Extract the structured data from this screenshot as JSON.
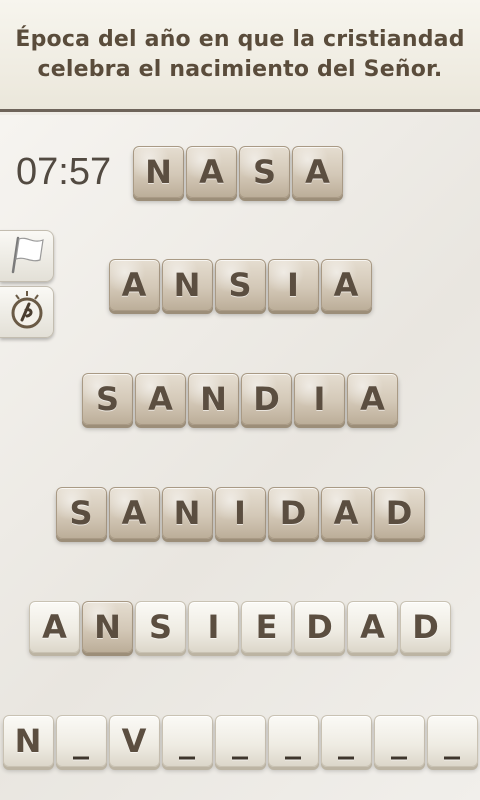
{
  "clue": {
    "line1": "Época del año en que la cristiandad",
    "line2": "celebra el nacimiento del Señor."
  },
  "timer": "07:57",
  "side_buttons": [
    {
      "icon": "flag-icon"
    },
    {
      "icon": "hint-bulb-icon"
    }
  ],
  "rows": [
    {
      "word": "NASA",
      "letters": [
        "N",
        "A",
        "S",
        "A"
      ],
      "style": [
        "dark",
        "dark",
        "dark",
        "dark"
      ]
    },
    {
      "word": "ANSIA",
      "letters": [
        "A",
        "N",
        "S",
        "I",
        "A"
      ],
      "style": [
        "dark",
        "dark",
        "dark",
        "dark",
        "dark"
      ]
    },
    {
      "word": "SANDIA",
      "letters": [
        "S",
        "A",
        "N",
        "D",
        "I",
        "A"
      ],
      "style": [
        "dark",
        "dark",
        "dark",
        "dark",
        "dark",
        "dark"
      ]
    },
    {
      "word": "SANIDAD",
      "letters": [
        "S",
        "A",
        "N",
        "I",
        "D",
        "A",
        "D"
      ],
      "style": [
        "dark",
        "dark",
        "dark",
        "dark",
        "dark",
        "dark",
        "dark"
      ]
    },
    {
      "word": "ANSIEDAD",
      "letters": [
        "A",
        "N",
        "S",
        "I",
        "E",
        "D",
        "A",
        "D"
      ],
      "style": [
        "light",
        "dark",
        "light",
        "light",
        "light",
        "light",
        "light",
        "light"
      ]
    },
    {
      "word": "",
      "letters": [
        "N",
        "_",
        "V",
        "_",
        "_",
        "_",
        "_",
        "_",
        "_"
      ],
      "style": [
        "light",
        "light",
        "light",
        "light",
        "light",
        "light",
        "light",
        "light",
        "light"
      ]
    }
  ],
  "colors": {
    "text_brown": "#5b4e40",
    "tile_dark": "#d3c8b7",
    "tile_light": "#eeebe2",
    "clue_border": "#6e645a"
  }
}
